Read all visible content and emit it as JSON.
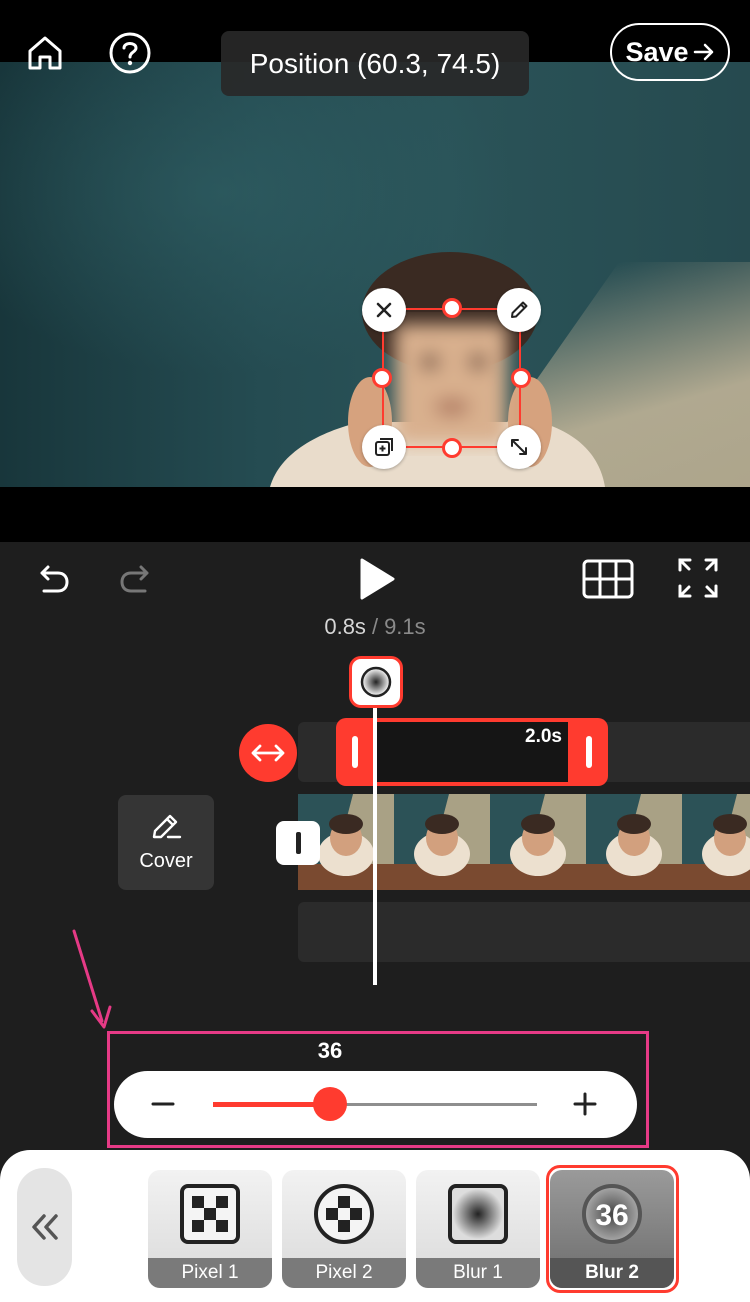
{
  "header": {
    "position_tooltip": "Position (60.3, 74.5)",
    "save_label": "Save"
  },
  "playback": {
    "current_time": "0.8s",
    "separator": "/",
    "total_time": "9.1s"
  },
  "timeline": {
    "effect_clip_duration": "2.0s",
    "cover_label": "Cover"
  },
  "intensity": {
    "value": "36",
    "fraction": 0.36
  },
  "effects": [
    {
      "label": "Pixel 1",
      "icon": "pixel-grid-icon"
    },
    {
      "label": "Pixel 2",
      "icon": "pixel-circle-icon"
    },
    {
      "label": "Blur 1",
      "icon": "blur-square-icon"
    },
    {
      "label": "Blur 2",
      "icon": "blur-circle-icon",
      "badge": "36",
      "selected": true
    }
  ],
  "colors": {
    "accent": "#ff3b2f",
    "annotation": "#e63a86"
  }
}
